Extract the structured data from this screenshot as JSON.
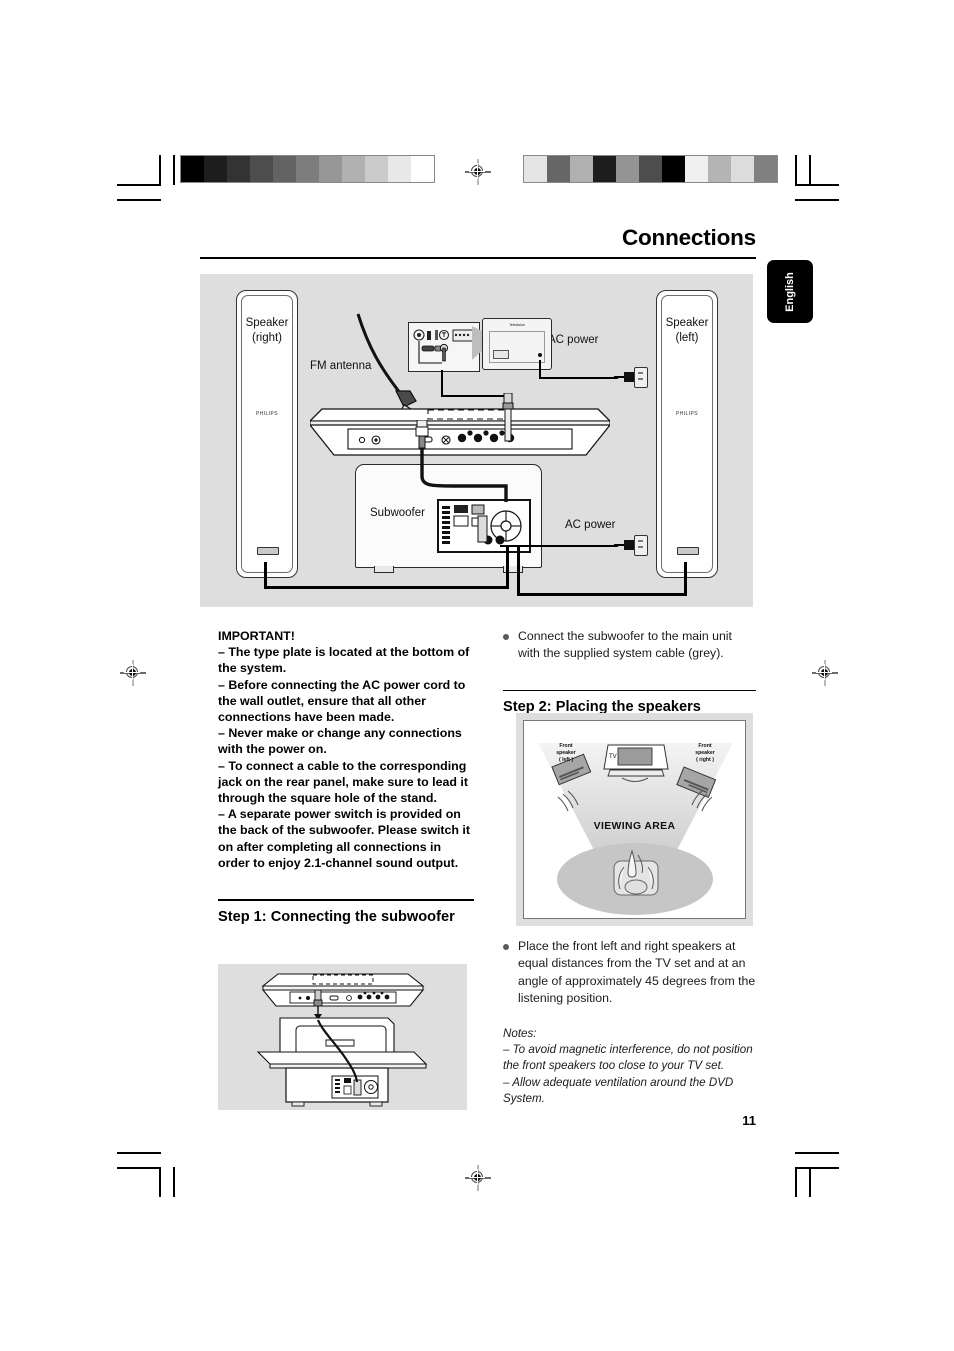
{
  "document": {
    "header_title": "Connections",
    "page_number": "11",
    "language_tab": "English"
  },
  "hero_diagram": {
    "name": "system-connection-diagram",
    "labels": {
      "speaker_right": "Speaker\n(right)",
      "speaker_right_line1": "Speaker",
      "speaker_right_line2": "(right)",
      "speaker_left_line1": "Speaker",
      "speaker_left_line2": "(left)",
      "fm_antenna": "FM antenna",
      "ac_power_top": "AC power",
      "ac_power_bottom": "AC power",
      "subwoofer": "Subwoofer",
      "television": "Television",
      "brand_mark": "PHILIPS"
    }
  },
  "important": {
    "heading": "IMPORTANT!",
    "items": [
      "–  The type plate is located at the bottom of the system.",
      "–  Before connecting the AC power cord to the wall outlet, ensure that all other connections have been made.",
      "–  Never make or change any connections with the power on.",
      "–  To connect a cable to the corresponding jack on the rear panel, make sure to lead it through the square hole of the stand.",
      "–  A separate power switch is provided on the back of the subwoofer. Please switch it on after completing all connections in order to enjoy 2.1-channel sound output."
    ]
  },
  "step1": {
    "heading": "Step 1: Connecting the subwoofer",
    "figure_name": "subwoofer-connection-figure"
  },
  "step2": {
    "heading": "Step 2: Placing the speakers",
    "figure_name": "speaker-placement-figure",
    "figure_labels": {
      "front_speaker_left_l1": "Front",
      "front_speaker_left_l2": "speaker",
      "front_speaker_left_l3": "( left )",
      "front_speaker_right_l1": "Front",
      "front_speaker_right_l2": "speaker",
      "front_speaker_right_l3": "( right )",
      "tv": "TV",
      "viewing_area": "VIEWING AREA"
    }
  },
  "right_column": {
    "bullet_1": "Connect the subwoofer to the main unit with the supplied system cable (grey).",
    "bullet_2": "Place the front left and right speakers at equal distances from the TV set and at an angle of approximately 45 degrees from the listening position.",
    "notes_heading": "Notes:",
    "note_1": "–  To avoid magnetic interference, do not position the front speakers too close to your TV set.",
    "note_2": "–  Allow adequate ventilation around the DVD System."
  },
  "printer_marks": {
    "calibration_bar_left": [
      "#000000",
      "#1d1d1d",
      "#333333",
      "#4d4d4d",
      "#636363",
      "#7d7d7d",
      "#969696",
      "#b0b0b0",
      "#cacaca",
      "#e8e8e8",
      "#ffffff"
    ],
    "calibration_bar_right": [
      "#e4e4e4",
      "#666666",
      "#b0b0b0",
      "#1d1d1d",
      "#949494",
      "#4d4d4d",
      "#000000",
      "#f0f0f0",
      "#b4b4b4",
      "#dcdcdc",
      "#808080"
    ]
  },
  "colors": {
    "figure_background": "#dedede",
    "text": "#000000",
    "accent_tab": "#000000"
  }
}
